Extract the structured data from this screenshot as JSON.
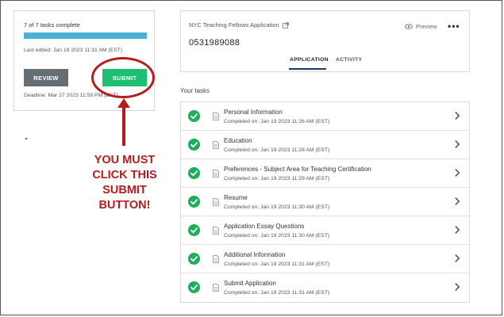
{
  "progress": {
    "label": "7 of 7 tasks complete",
    "fraction": 1.0
  },
  "left_card": {
    "last_edited": "Last edited: Jan 19 2023 11:31 AM (EST)",
    "review_label": "REVIEW",
    "submit_label": "SUBMIT",
    "deadline": "Deadline: Mar 27 2023 11:59 PM (EST)"
  },
  "annotation": {
    "text": "YOU MUST CLICK THIS SUBMIT BUTTON!",
    "color": "#b71c1c"
  },
  "application": {
    "title": "NYC Teaching Fellows Application",
    "id": "0531989088",
    "preview_label": "Preview",
    "tabs": [
      {
        "label": "APPLICATION",
        "active": true
      },
      {
        "label": "ACTIVITY",
        "active": false
      }
    ]
  },
  "tasks": {
    "heading": "Your tasks",
    "items": [
      {
        "name": "Personal Information",
        "meta": "Completed on: Jan 19 2023 11:26 AM (EST)"
      },
      {
        "name": "Education",
        "meta": "Completed on: Jan 19 2023 11:28 AM (EST)"
      },
      {
        "name": "Preferences - Subject Area for Teaching Certification",
        "meta": "Completed on: Jan 19 2023 11:29 AM (EST)"
      },
      {
        "name": "Resume",
        "meta": "Completed on: Jan 19 2023 11:30 AM (EST)"
      },
      {
        "name": "Application Essay Questions",
        "meta": "Completed on: Jan 19 2023 11:30 AM (EST)"
      },
      {
        "name": "Additional Information",
        "meta": "Completed on: Jan 19 2023 11:31 AM (EST)"
      },
      {
        "name": "Submit Application",
        "meta": "Completed on: Jan 19 2023 11:31 AM (EST)"
      }
    ]
  },
  "colors": {
    "submit": "#1fbf72",
    "review": "#666e75",
    "progress": "#4bb2d6",
    "check": "#1fae5b",
    "accent": "#1e3a5f"
  }
}
